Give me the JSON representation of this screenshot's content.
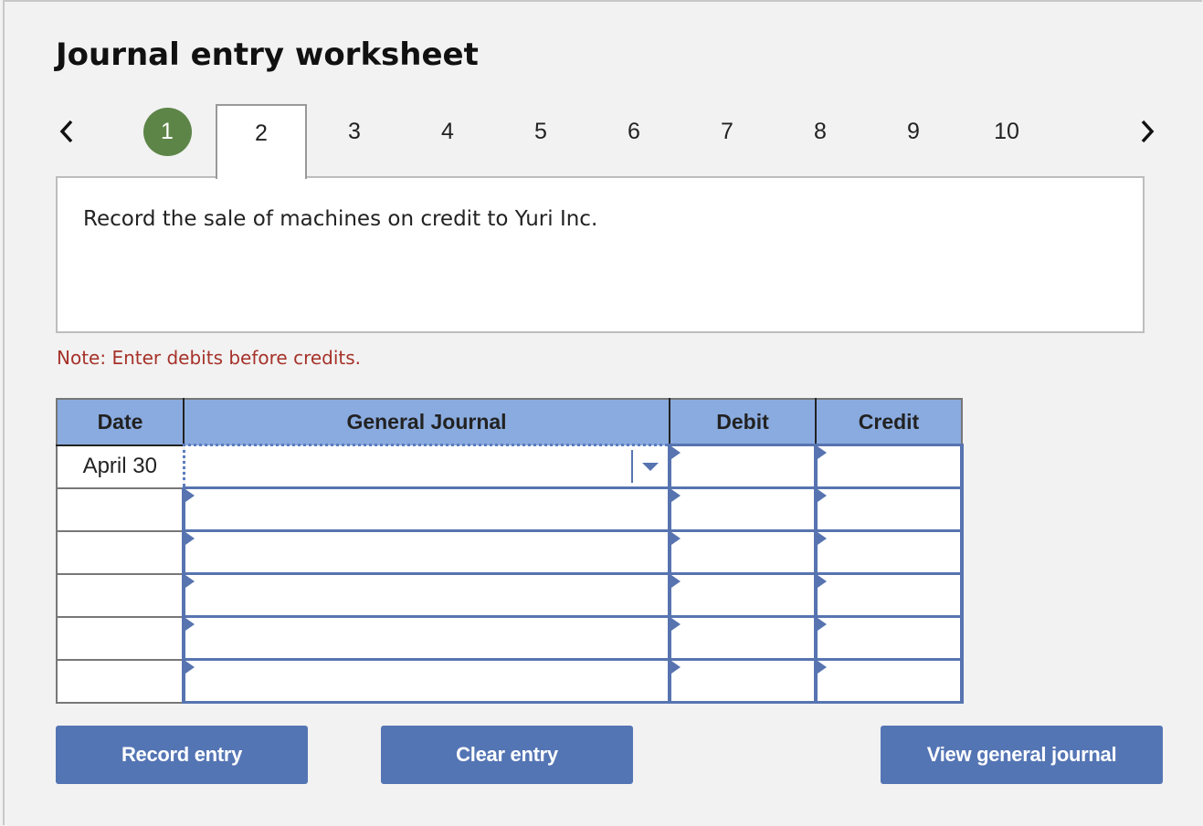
{
  "title": "Journal entry worksheet",
  "pagination": {
    "prev_icon": "chevron-left-icon",
    "next_icon": "chevron-right-icon",
    "tabs": [
      {
        "label": "1",
        "state": "completed"
      },
      {
        "label": "2",
        "state": "active"
      },
      {
        "label": "3",
        "state": "default"
      },
      {
        "label": "4",
        "state": "default"
      },
      {
        "label": "5",
        "state": "default"
      },
      {
        "label": "6",
        "state": "default"
      },
      {
        "label": "7",
        "state": "default"
      },
      {
        "label": "8",
        "state": "default"
      },
      {
        "label": "9",
        "state": "default"
      },
      {
        "label": "10",
        "state": "default"
      }
    ],
    "completed_color": "#5e8548"
  },
  "prompt": "Record the sale of machines on credit to Yuri Inc.",
  "note": "Note: Enter debits before credits.",
  "journal": {
    "columns": [
      "Date",
      "General Journal",
      "Debit",
      "Credit"
    ],
    "header_color": "#8aabdf",
    "rows": [
      {
        "date": "April 30",
        "account": "",
        "debit": "",
        "credit": ""
      },
      {
        "date": "",
        "account": "",
        "debit": "",
        "credit": ""
      },
      {
        "date": "",
        "account": "",
        "debit": "",
        "credit": ""
      },
      {
        "date": "",
        "account": "",
        "debit": "",
        "credit": ""
      },
      {
        "date": "",
        "account": "",
        "debit": "",
        "credit": ""
      },
      {
        "date": "",
        "account": "",
        "debit": "",
        "credit": ""
      }
    ]
  },
  "buttons": {
    "record": "Record entry",
    "clear": "Clear entry",
    "view": "View general journal",
    "color": "#5475b4"
  }
}
